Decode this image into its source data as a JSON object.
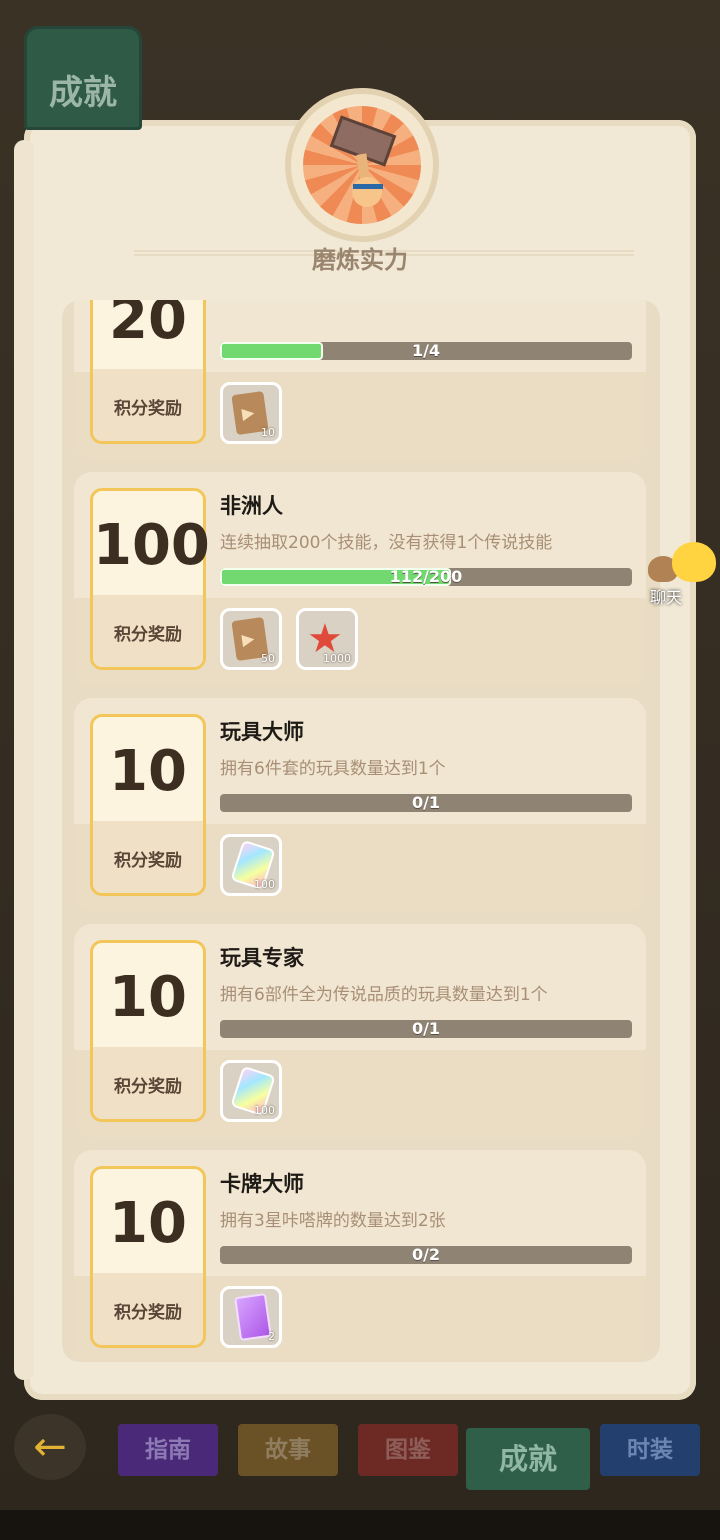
{
  "header": {
    "title": "成就",
    "category_title": "磨炼实力"
  },
  "achievements": [
    {
      "title": "",
      "description": "",
      "score": "20",
      "score_label": "积分奖励",
      "progress_text": "1/4",
      "progress_fraction": 0.25,
      "rewards": [
        {
          "icon": "ticket-icon",
          "count": "10"
        }
      ]
    },
    {
      "title": "非洲人",
      "description": "连续抽取200个技能，没有获得1个传说技能",
      "score": "100",
      "score_label": "积分奖励",
      "progress_text": "112/200",
      "progress_fraction": 0.56,
      "rewards": [
        {
          "icon": "ticket-icon",
          "count": "50"
        },
        {
          "icon": "starfish-icon",
          "count": "1000"
        }
      ]
    },
    {
      "title": "玩具大师",
      "description": "拥有6件套的玩具数量达到1个",
      "score": "10",
      "score_label": "积分奖励",
      "progress_text": "0/1",
      "progress_fraction": 0,
      "rewards": [
        {
          "icon": "crystal-icon",
          "count": "100"
        }
      ]
    },
    {
      "title": "玩具专家",
      "description": "拥有6部件全为传说品质的玩具数量达到1个",
      "score": "10",
      "score_label": "积分奖励",
      "progress_text": "0/1",
      "progress_fraction": 0,
      "rewards": [
        {
          "icon": "crystal-icon",
          "count": "100"
        }
      ]
    },
    {
      "title": "卡牌大师",
      "description": "拥有3星咔嗒牌的数量达到2张",
      "score": "10",
      "score_label": "积分奖励",
      "progress_text": "0/2",
      "progress_fraction": 0,
      "rewards": [
        {
          "icon": "card-icon",
          "count": "2"
        }
      ]
    }
  ],
  "chat": {
    "label": "聊天"
  },
  "tabs": [
    {
      "label": "指南",
      "color": "#4a2a78",
      "text_color": "#8d79b4"
    },
    {
      "label": "故事",
      "color": "#6b5226",
      "text_color": "#8f7d5f"
    },
    {
      "label": "图鉴",
      "color": "#6d2a24",
      "text_color": "#8e5d57"
    },
    {
      "label": "成就",
      "color": "#2f5f48",
      "text_color": "#8fb7a3",
      "active": true
    },
    {
      "label": "时装",
      "color": "#233f6d",
      "text_color": "#6c86b3"
    }
  ]
}
